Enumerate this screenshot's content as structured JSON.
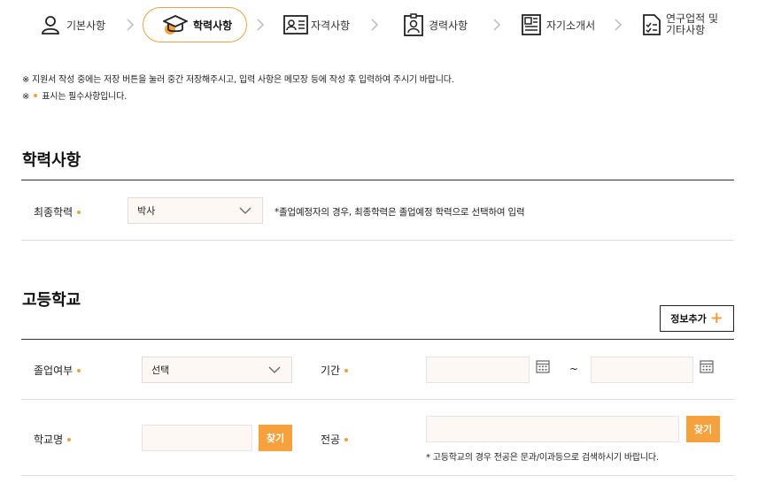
{
  "steps": {
    "basic": "기본사항",
    "education": "학력사항",
    "certificate": "자격사항",
    "career": "경력사항",
    "intro": "자기소개서",
    "research_line1": "연구업적 및",
    "research_line2": "기타사항"
  },
  "notices": {
    "line1": "※ 지원서 작성 중에는 저장 버튼을 눌러 중간 저장해주시고, 입력 사항은 메모장 등에 작성 후 입력하여 주시기 바랍니다.",
    "line2_prefix": "※",
    "line2_suffix": "표시는 필수사항입니다."
  },
  "education_section": {
    "title": "학력사항",
    "final_label": "최종학력",
    "final_value": "박사",
    "final_hint": "*졸업예정자의 경우, 최종학력은 졸업예정 학력으로 선택하여 입력"
  },
  "highschool_section": {
    "title": "고등학교",
    "add_button": "정보추가",
    "graduation_label": "졸업여부",
    "graduation_value": "선택",
    "period_label": "기간",
    "period_separator": "~",
    "school_label": "학교명",
    "find_button": "찾기",
    "major_label": "전공",
    "major_find_button": "찾기",
    "major_hint": "* 고등학교의 경우 전공은 문과/이과등으로 검색하시기 바랍니다."
  },
  "colors": {
    "accent": "#f5a13d",
    "field_bg": "#fdf8f3"
  }
}
